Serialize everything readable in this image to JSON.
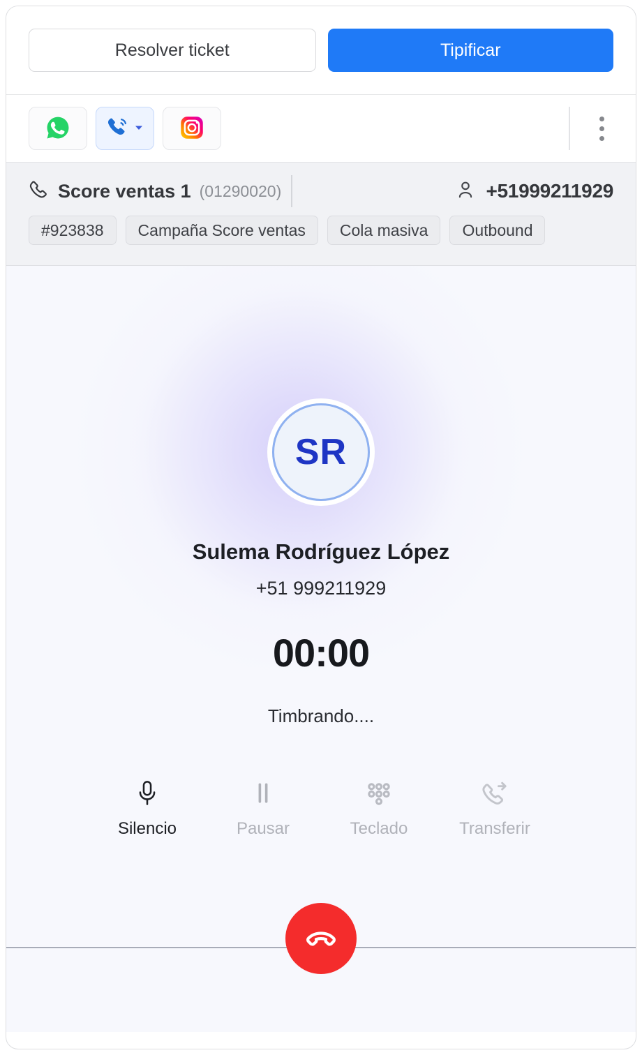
{
  "top_actions": {
    "resolve_label": "Resolver ticket",
    "tipificar_label": "Tipificar"
  },
  "channels": {
    "items": [
      {
        "name": "whatsapp",
        "icon": "whatsapp-icon",
        "active": false
      },
      {
        "name": "phone",
        "icon": "phone-call-icon",
        "active": true
      },
      {
        "name": "instagram",
        "icon": "instagram-icon",
        "active": false
      }
    ],
    "more_menu_icon": "kebab-menu-icon"
  },
  "ticket": {
    "icon": "phone-handset-icon",
    "title": "Score ventas 1",
    "code": "(01290020)",
    "contact_icon": "person-icon",
    "contact_phone": "+51999211929",
    "tags": [
      "#923838",
      "Campaña Score ventas",
      "Cola masiva",
      "Outbound"
    ]
  },
  "call": {
    "avatar_initials": "SR",
    "caller_name": "Sulema Rodríguez López",
    "caller_phone": "+51 999211929",
    "timer": "00:00",
    "status": "Timbrando....",
    "controls": [
      {
        "label": "Silencio",
        "icon": "microphone-icon",
        "disabled": false
      },
      {
        "label": "Pausar",
        "icon": "pause-icon",
        "disabled": true
      },
      {
        "label": "Teclado",
        "icon": "dialpad-icon",
        "disabled": true
      },
      {
        "label": "Transferir",
        "icon": "phone-forward-icon",
        "disabled": true
      }
    ],
    "hangup_icon": "hangup-phone-icon"
  },
  "colors": {
    "accent_blue": "#1f7af7",
    "hangup_red": "#f42c2c",
    "panel_bg": "#f7f8fd",
    "ticket_bar_bg": "#f1f2f5",
    "avatar_text": "#1e35c4",
    "whatsapp_green": "#25d366"
  }
}
